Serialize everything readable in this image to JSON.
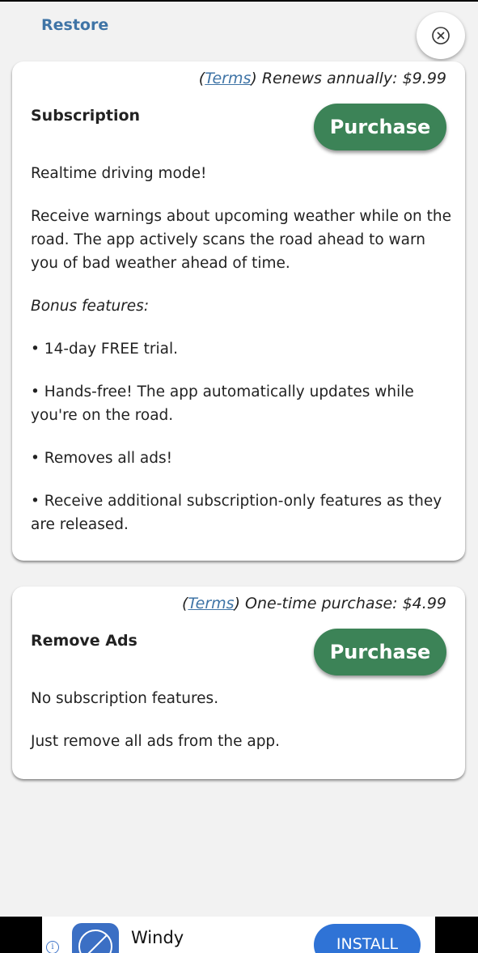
{
  "header": {
    "restore_label": "Restore",
    "close_icon": "close-circle-icon"
  },
  "subscription_card": {
    "terms_open": "(",
    "terms_link": "Terms",
    "terms_rest": ") Renews annually: $9.99",
    "title": "Subscription",
    "purchase_label": "Purchase",
    "paragraphs": [
      "Realtime driving mode!",
      "Receive warnings about upcoming weather while on the road. The app actively scans the road ahead to warn you of bad weather ahead of time.",
      "Bonus features:",
      "• 14-day FREE trial.",
      "• Hands-free! The app automatically updates while you're on the road.",
      "• Removes all ads!",
      "• Receive additional subscription-only features as they are released."
    ]
  },
  "remove_ads_card": {
    "terms_open": "(",
    "terms_link": "Terms",
    "terms_rest": ") One-time purchase: $4.99",
    "title": "Remove Ads",
    "purchase_label": "Purchase",
    "paragraphs": [
      "No subscription features.",
      "Just remove all ads from the app."
    ]
  },
  "ad_banner": {
    "info_glyph": "i",
    "app_name": "Windy",
    "install_label": "INSTALL",
    "colors": {
      "install": "#2f73d6",
      "app_icon": "#3b6fc4"
    }
  },
  "colors": {
    "accent_link": "#3f74a6",
    "purchase_button": "#3c8357",
    "background": "#f2f2f2"
  }
}
